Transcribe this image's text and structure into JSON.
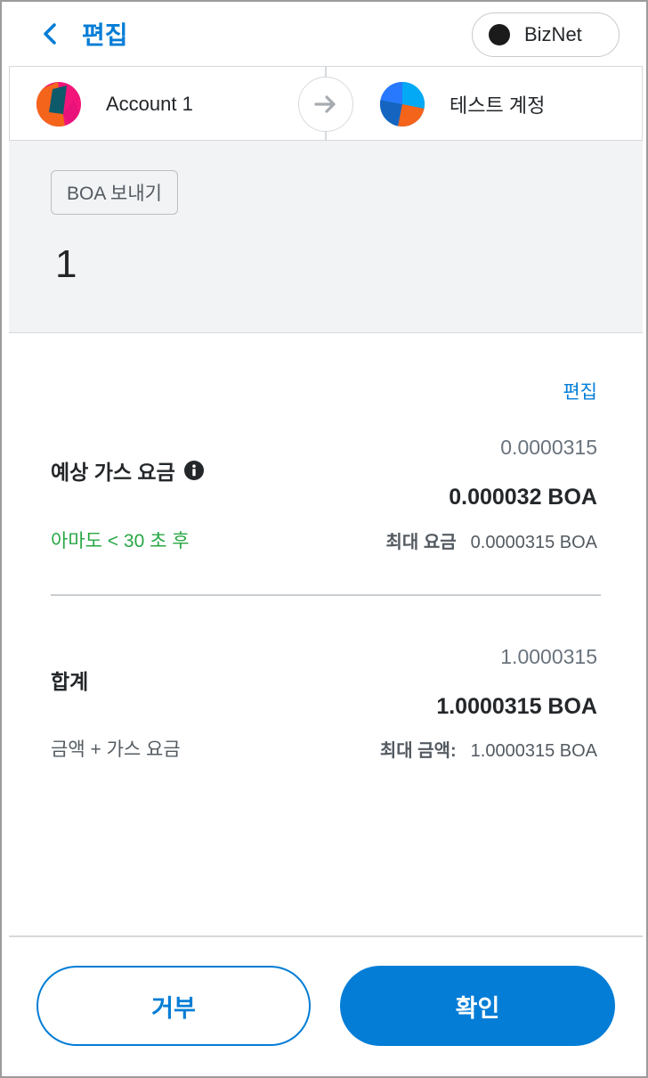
{
  "header": {
    "back_label": "편집",
    "network_name": "BizNet"
  },
  "accounts": {
    "from_name": "Account 1",
    "to_name": "테스트 계정"
  },
  "summary": {
    "method": "BOA 보내기",
    "amount": "1"
  },
  "details": {
    "edit_label": "편집",
    "gas": {
      "label": "예상 가스 요금",
      "secondary_value": "0.0000315",
      "primary_value": "0.000032 BOA",
      "timing": "아마도 < 30 초 후",
      "max_label": "최대 요금",
      "max_value": "0.0000315 BOA"
    },
    "total": {
      "label": "합계",
      "secondary_value": "1.0000315",
      "primary_value": "1.0000315 BOA",
      "subtitle": "금액 + 가스 요금",
      "max_label": "최대 금액:",
      "max_value": "1.0000315 BOA"
    }
  },
  "footer": {
    "reject_label": "거부",
    "confirm_label": "확인"
  },
  "colors": {
    "accent": "#037dd6",
    "success": "#28a745",
    "summary_bg": "#f2f3f4"
  },
  "icons": {
    "back": "chevron-left-icon",
    "network": "network-dot",
    "arrow": "arrow-right-icon",
    "info": "info-icon"
  }
}
